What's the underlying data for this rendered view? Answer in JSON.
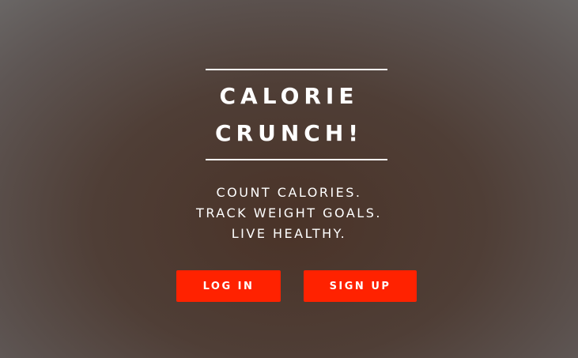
{
  "hero": {
    "title_line_1": "CALORIE",
    "title_line_2": "CRUNCH!",
    "tagline": [
      "COUNT CALORIES.",
      "TRACK WEIGHT GOALS.",
      "LIVE HEALTHY."
    ]
  },
  "actions": {
    "login_label": "LOG IN",
    "signup_label": "SIGN UP"
  },
  "colors": {
    "accent": "#ff2200",
    "text": "#ffffff",
    "background": "#4f3e36"
  }
}
